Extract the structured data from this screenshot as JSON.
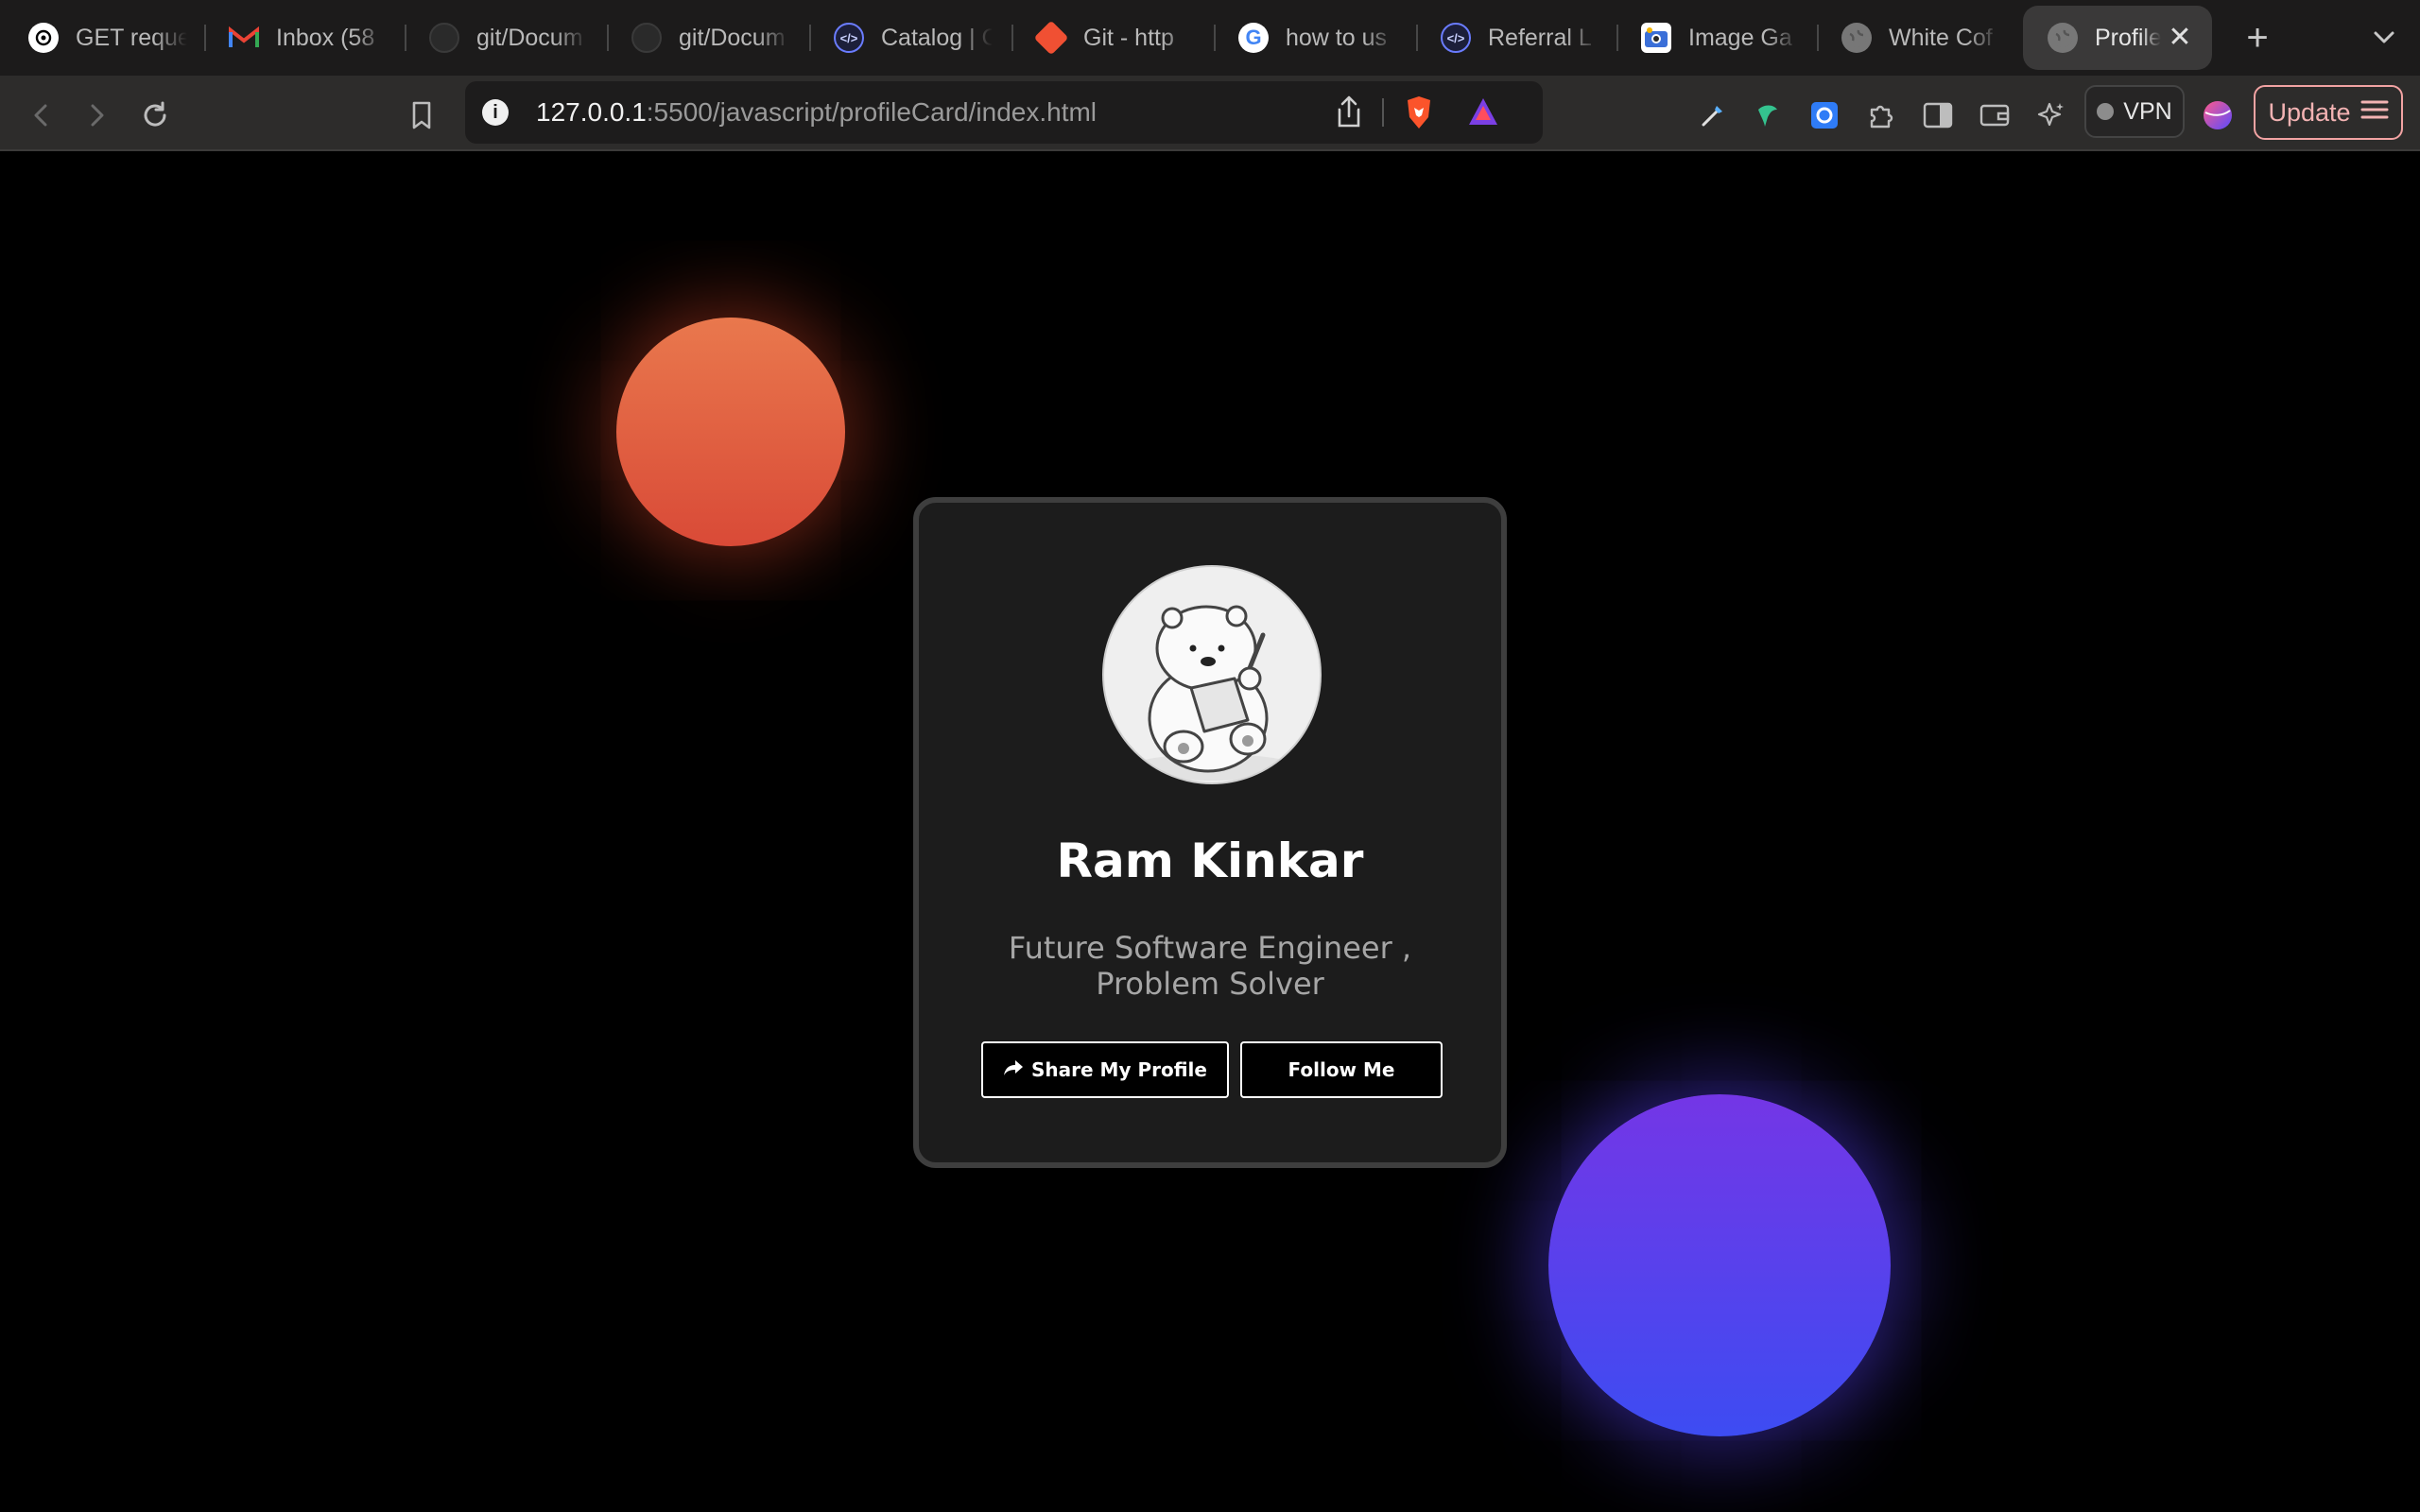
{
  "tabs": [
    {
      "title": "GET reque",
      "icon": "openai-icon"
    },
    {
      "title": "Inbox (58",
      "icon": "gmail-icon"
    },
    {
      "title": "git/Docum",
      "icon": "github-icon"
    },
    {
      "title": "git/Docum",
      "icon": "github-icon"
    },
    {
      "title": "Catalog | C",
      "icon": "code-icon"
    },
    {
      "title": "Git - http",
      "icon": "git-icon"
    },
    {
      "title": "how to us",
      "icon": "google-icon"
    },
    {
      "title": "Referral L",
      "icon": "code-icon"
    },
    {
      "title": "Image Ga",
      "icon": "image-gallery-icon"
    },
    {
      "title": "White Cof",
      "icon": "globe-icon"
    },
    {
      "title": "Profile",
      "icon": "globe-icon",
      "active": true
    }
  ],
  "address_bar": {
    "host": "127.0.0.1",
    "path": ":5500/javascript/profileCard/index.html"
  },
  "toolbar": {
    "vpn_label": "VPN",
    "update_label": "Update"
  },
  "profile": {
    "name": "Ram Kinkar",
    "title": "Future Software Engineer , Problem Solver",
    "share_label": "Share My Profile",
    "follow_label": "Follow Me"
  },
  "colors": {
    "orb_orange": "#e0603f",
    "orb_blue": "#5a40ee",
    "card_bg": "#1c1c1c",
    "update_accent": "#f2a3a3"
  }
}
